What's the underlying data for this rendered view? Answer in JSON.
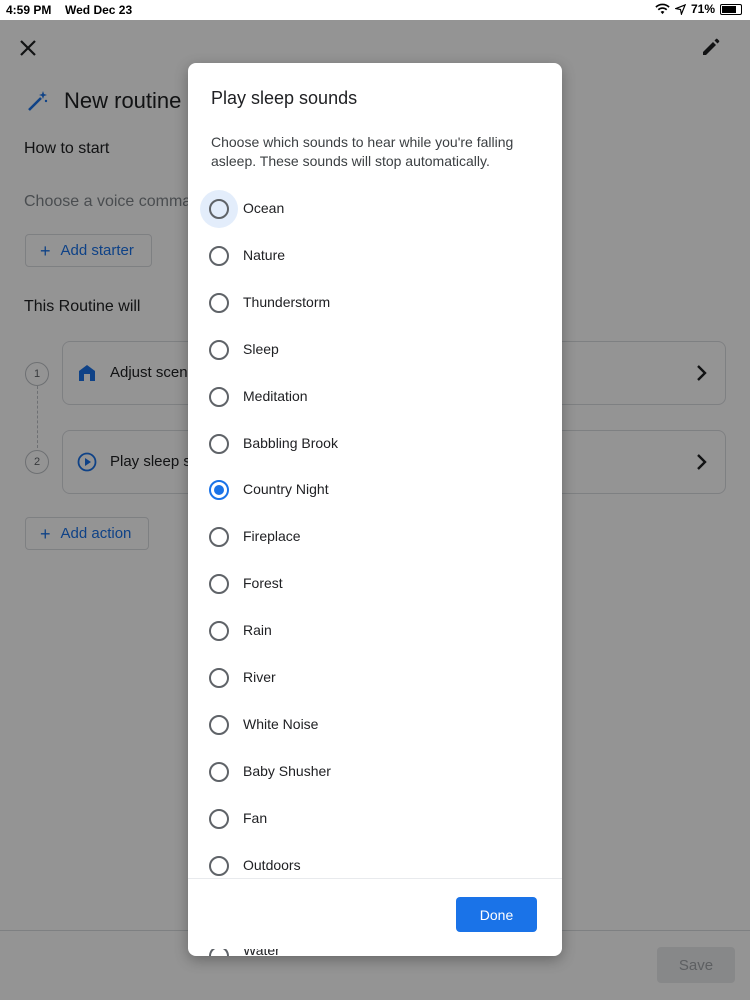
{
  "status_bar": {
    "time": "4:59 PM",
    "date": "Wed Dec 23",
    "battery": "71%",
    "battery_level": 0.71
  },
  "background": {
    "title": "New routine",
    "how_to_start": "How to start",
    "voice_placeholder": "Choose a voice comma",
    "add_starter": "Add starter",
    "routine_will": "This Routine will",
    "steps": [
      {
        "number": "1",
        "label": "Adjust scene",
        "icon": "home-icon"
      },
      {
        "number": "2",
        "label": "Play sleep sc",
        "icon": "play-circle-icon"
      }
    ],
    "add_action": "Add action",
    "save": "Save"
  },
  "dialog": {
    "title": "Play sleep sounds",
    "description": "Choose which sounds to hear while you're falling asleep. These sounds will stop automatically.",
    "options": [
      {
        "label": "Ocean",
        "selected": false,
        "focused": true
      },
      {
        "label": "Nature",
        "selected": false
      },
      {
        "label": "Thunderstorm",
        "selected": false
      },
      {
        "label": "Sleep",
        "selected": false
      },
      {
        "label": "Meditation",
        "selected": false
      },
      {
        "label": "Babbling Brook",
        "selected": false
      },
      {
        "label": "Country Night",
        "selected": true
      },
      {
        "label": "Fireplace",
        "selected": false
      },
      {
        "label": "Forest",
        "selected": false
      },
      {
        "label": "Rain",
        "selected": false
      },
      {
        "label": "River",
        "selected": false
      },
      {
        "label": "White Noise",
        "selected": false
      },
      {
        "label": "Baby Shusher",
        "selected": false
      },
      {
        "label": "Fan",
        "selected": false
      },
      {
        "label": "Outdoors",
        "selected": false
      }
    ],
    "peek_option": "Water",
    "done": "Done"
  },
  "colors": {
    "accent": "#1a73e8",
    "scrim": "rgba(0,0,0,0.42)"
  }
}
